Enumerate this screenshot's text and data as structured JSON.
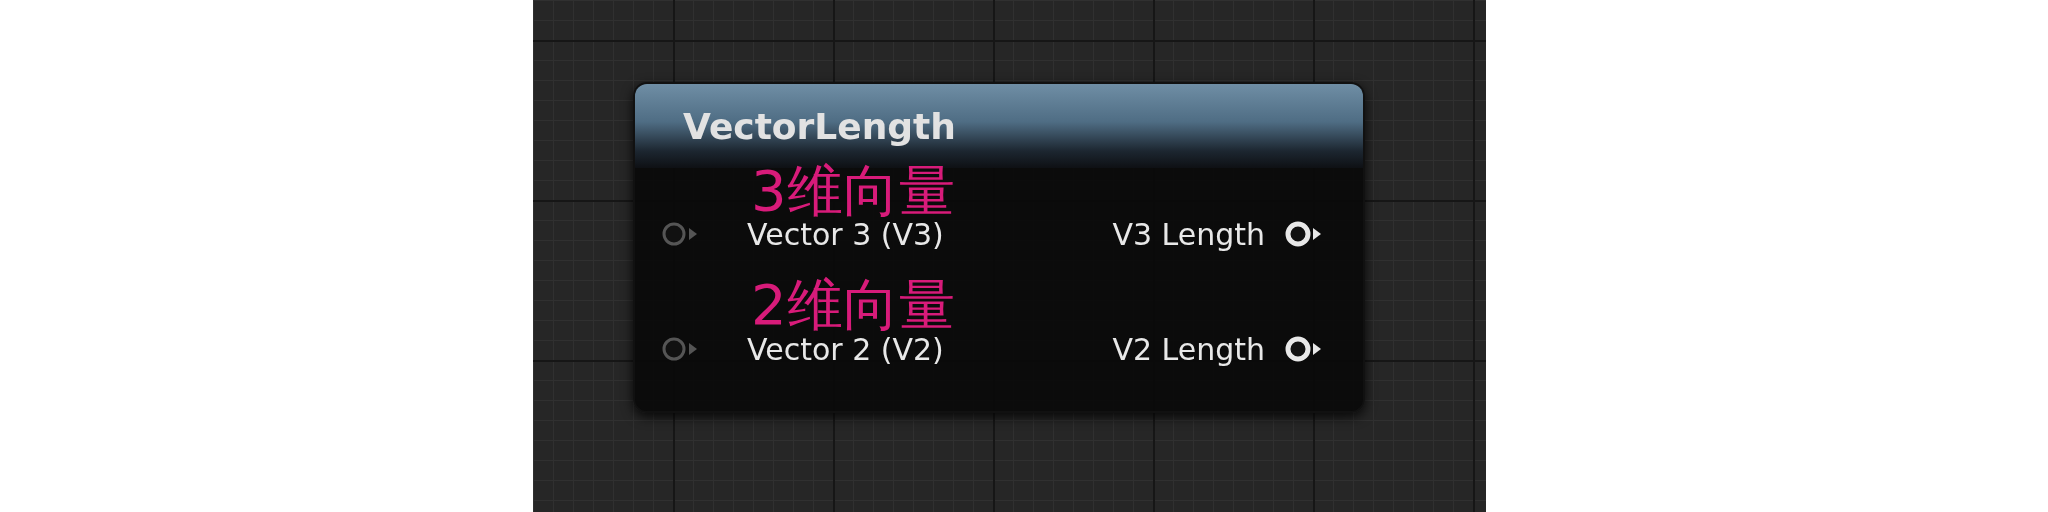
{
  "node": {
    "title": "VectorLength",
    "pins": [
      {
        "input": "Vector 3 (V3)",
        "output": "V3 Length"
      },
      {
        "input": "Vector 2 (V2)",
        "output": "V2 Length"
      }
    ]
  },
  "annotations": [
    {
      "text": "3维向量"
    },
    {
      "text": "2维向量"
    }
  ]
}
